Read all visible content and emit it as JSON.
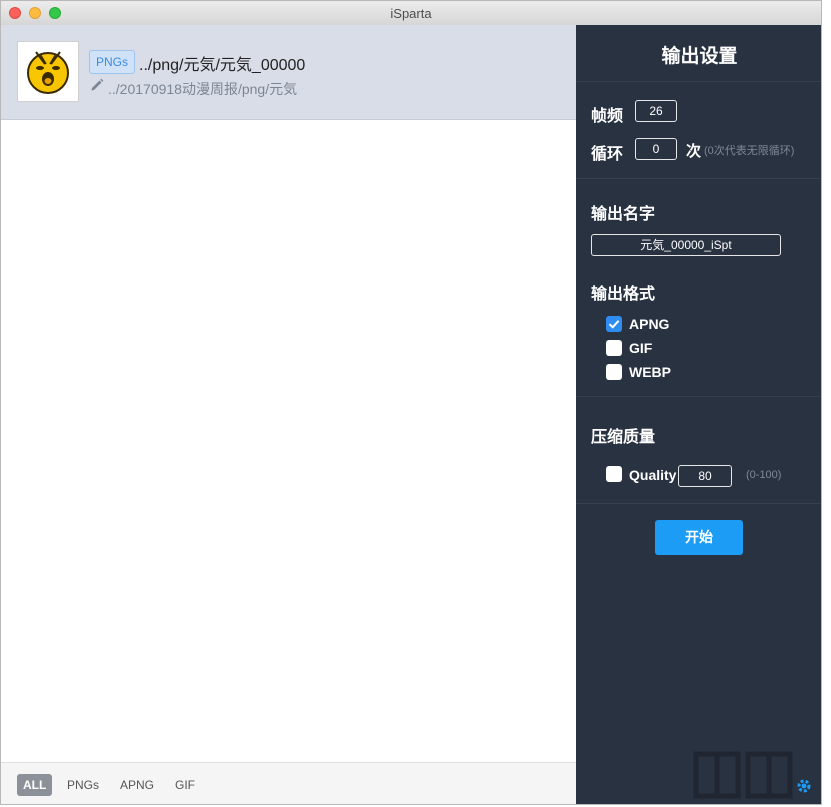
{
  "window": {
    "title": "iSparta"
  },
  "file": {
    "badge": "PNGs",
    "name": "../png/元気/元気_00000",
    "path": "../20170918动漫周报/png/元気",
    "thumbnail_icon": "emoji-surprised-face-icon"
  },
  "filters": {
    "items": [
      "ALL",
      "PNGs",
      "APNG",
      "GIF"
    ],
    "active": "ALL"
  },
  "settings": {
    "title": "输出设置",
    "frame_rate_label": "帧频",
    "frame_rate_value": "26",
    "loop_label": "循环",
    "loop_value": "0",
    "loop_unit": "次",
    "loop_hint": "(0次代表无限循环)",
    "output_name_label": "输出名字",
    "output_name_value": "元気_00000_iSpt",
    "output_format_label": "输出格式",
    "formats": [
      {
        "label": "APNG",
        "checked": true
      },
      {
        "label": "GIF",
        "checked": false
      },
      {
        "label": "WEBP",
        "checked": false
      }
    ],
    "compression_label": "压缩质量",
    "quality_label": "Quality",
    "quality_checked": false,
    "quality_value": "80",
    "quality_range": "(0-100)",
    "start_label": "开始"
  },
  "colors": {
    "accent": "#1c9cf5",
    "panel_bg": "#293241",
    "selected_row": "#d9dde7"
  }
}
